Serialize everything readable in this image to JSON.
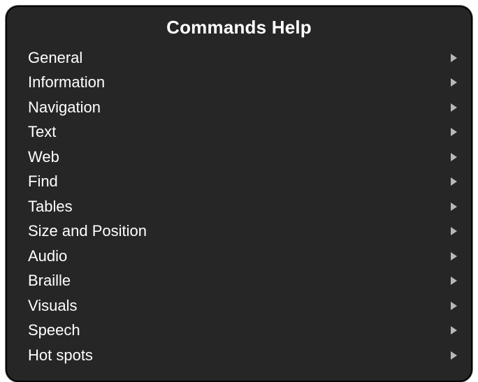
{
  "title": "Commands Help",
  "menu": {
    "items": [
      {
        "label": "General"
      },
      {
        "label": "Information"
      },
      {
        "label": "Navigation"
      },
      {
        "label": "Text"
      },
      {
        "label": "Web"
      },
      {
        "label": "Find"
      },
      {
        "label": "Tables"
      },
      {
        "label": "Size and Position"
      },
      {
        "label": "Audio"
      },
      {
        "label": "Braille"
      },
      {
        "label": "Visuals"
      },
      {
        "label": "Speech"
      },
      {
        "label": "Hot spots"
      }
    ]
  }
}
